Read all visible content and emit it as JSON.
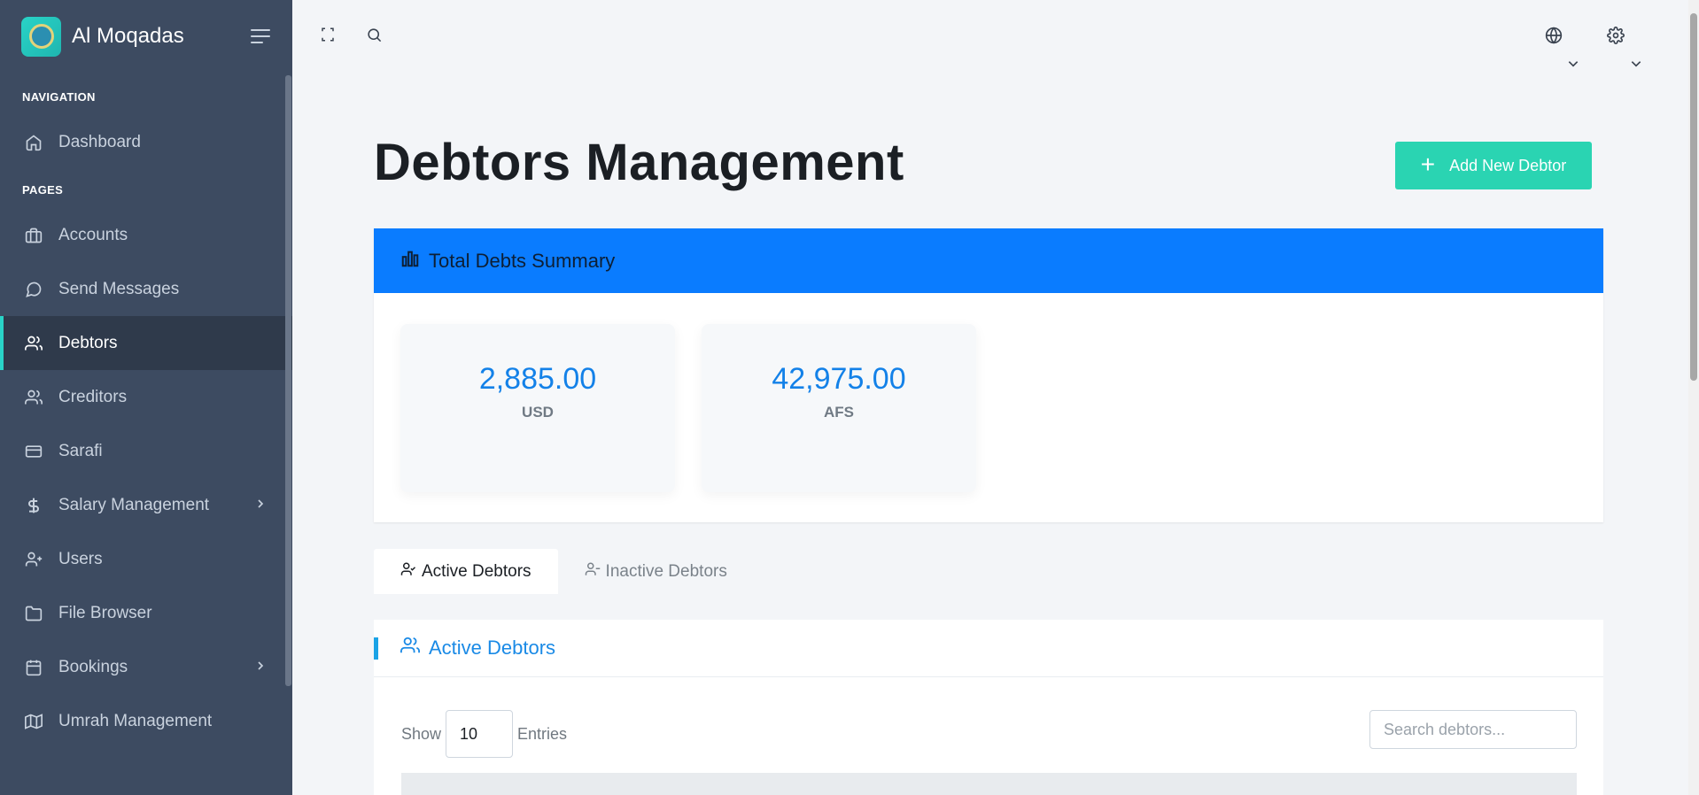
{
  "app": {
    "name": "Al Moqadas"
  },
  "sidebar": {
    "sections": [
      {
        "title": "NAVIGATION",
        "items": [
          {
            "label": "Dashboard",
            "icon": "home-icon"
          }
        ]
      },
      {
        "title": "PAGES",
        "items": [
          {
            "label": "Accounts",
            "icon": "briefcase-icon"
          },
          {
            "label": "Send Messages",
            "icon": "message-circle-icon"
          },
          {
            "label": "Debtors",
            "icon": "users-icon",
            "active": true
          },
          {
            "label": "Creditors",
            "icon": "users-icon"
          },
          {
            "label": "Sarafi",
            "icon": "credit-card-icon"
          },
          {
            "label": "Salary Management",
            "icon": "dollar-icon",
            "has_submenu": true
          },
          {
            "label": "Users",
            "icon": "user-plus-icon"
          },
          {
            "label": "File Browser",
            "icon": "folder-icon"
          },
          {
            "label": "Bookings",
            "icon": "calendar-icon",
            "has_submenu": true
          },
          {
            "label": "Umrah Management",
            "icon": "map-icon"
          }
        ]
      }
    ]
  },
  "topbar": {
    "icons": [
      "fullscreen-icon",
      "search-icon",
      "globe-icon",
      "settings-icon"
    ]
  },
  "page": {
    "title": "Debtors Management",
    "add_button": "Add New Debtor"
  },
  "summary": {
    "title": "Total Debts Summary",
    "stats": [
      {
        "value": "2,885.00",
        "currency": "USD"
      },
      {
        "value": "42,975.00",
        "currency": "AFS"
      }
    ]
  },
  "tabs": [
    {
      "label": "Active Debtors",
      "active": true
    },
    {
      "label": "Inactive Debtors",
      "active": false
    }
  ],
  "list": {
    "title": "Active Debtors",
    "show_label": "Show",
    "entries_value": "10",
    "entries_label": "Entries",
    "search_placeholder": "Search debtors..."
  },
  "colors": {
    "sidebar": "#3d4b61",
    "accent": "#2ad4b2",
    "primary": "#0a7cff",
    "stat_value": "#1381e8"
  }
}
